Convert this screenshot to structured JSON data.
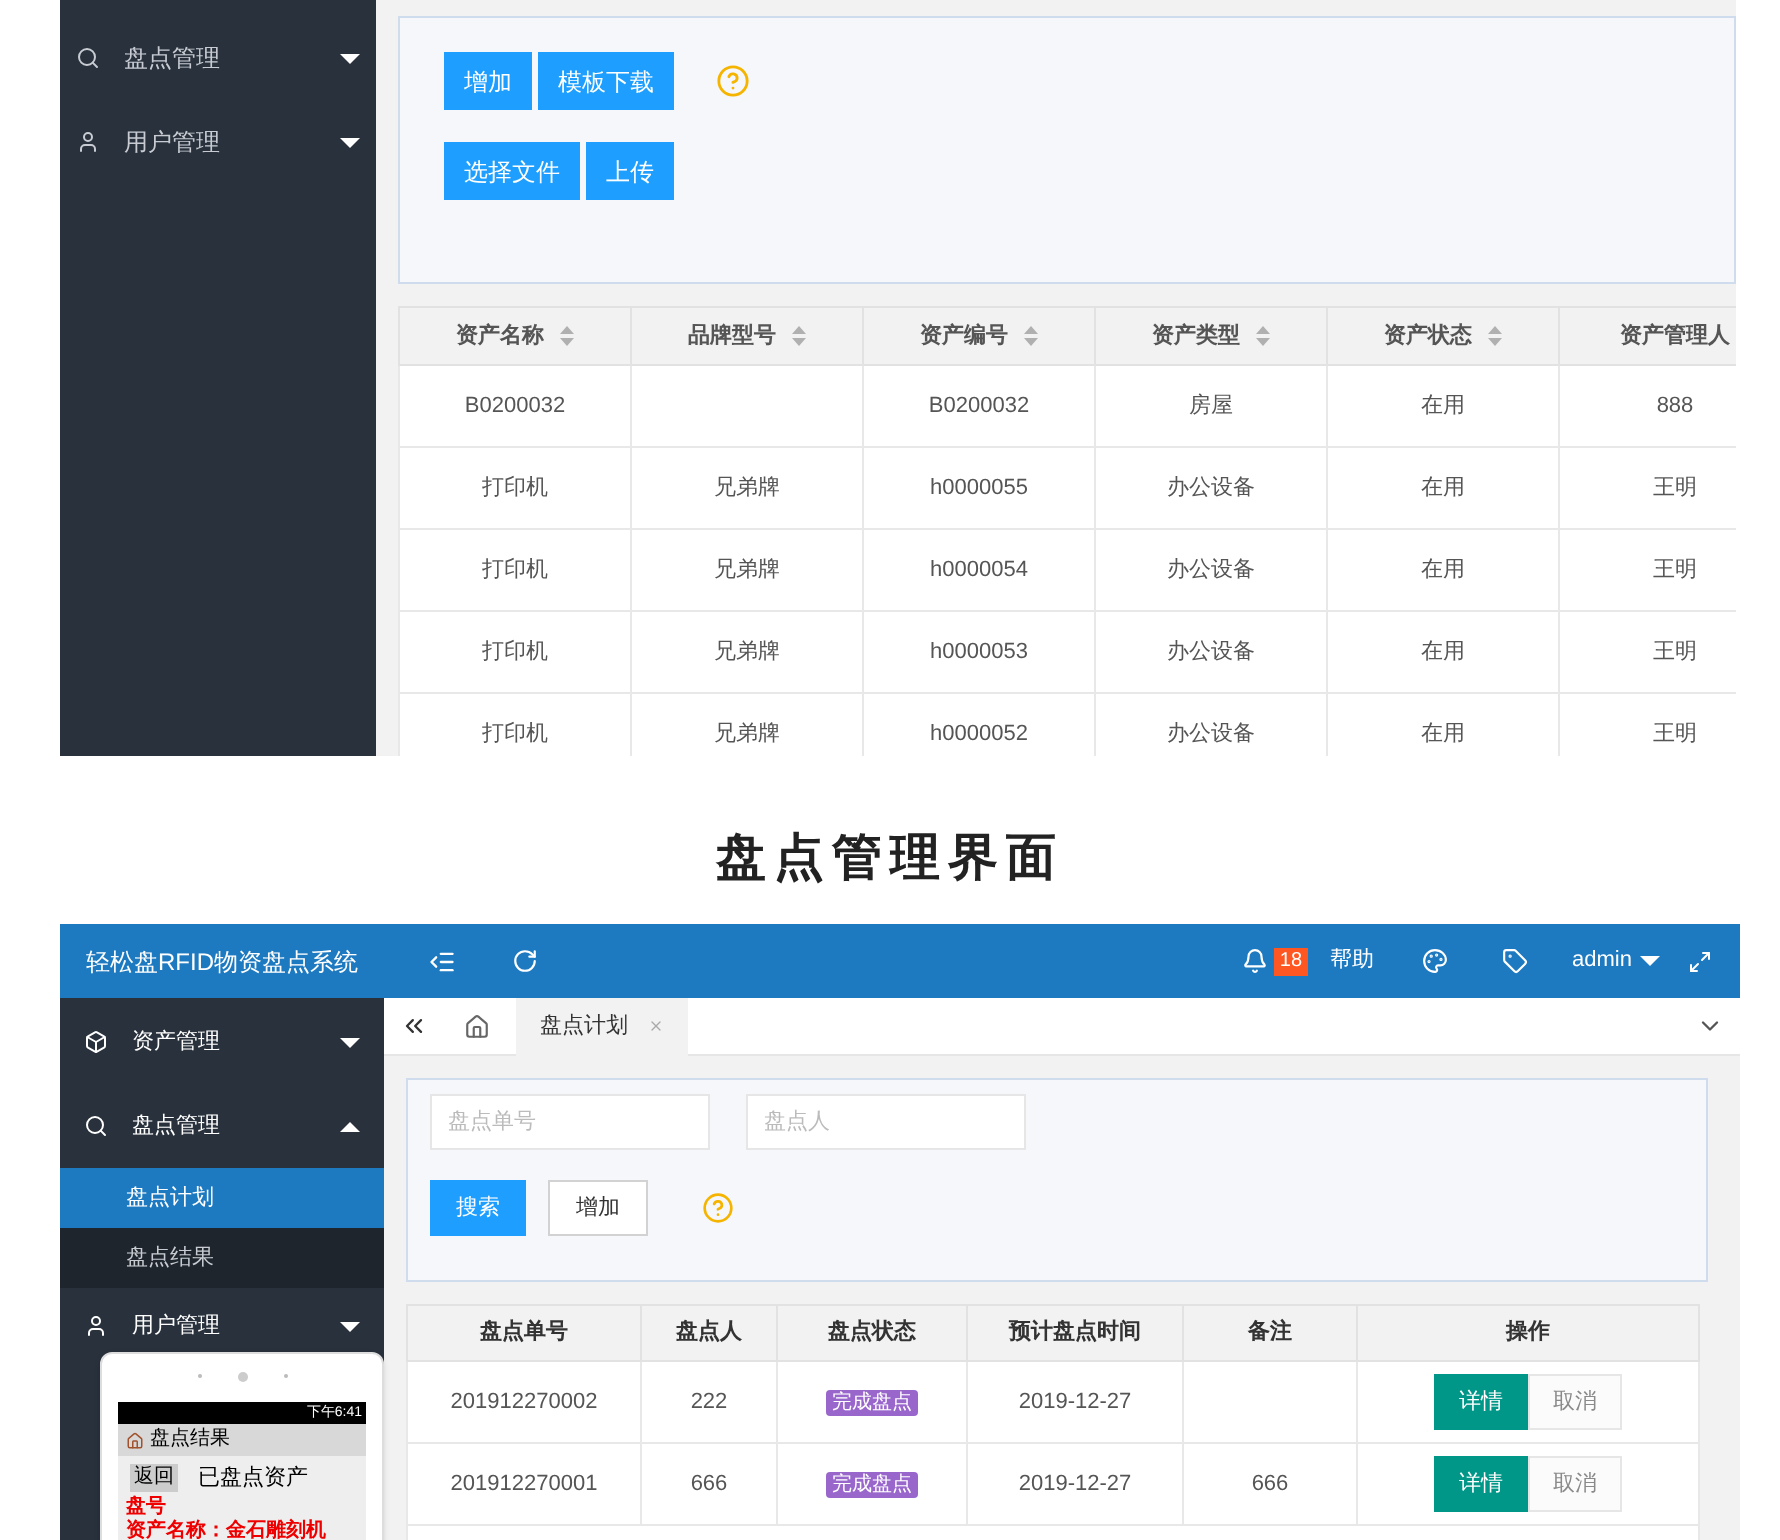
{
  "asset_screen": {
    "sidebar": {
      "items": [
        {
          "label": "盘点管理",
          "expanded": false
        },
        {
          "label": "用户管理",
          "expanded": false
        }
      ]
    },
    "toolbar": {
      "rows": [
        [
          "增加",
          "模板下载"
        ],
        [
          "选择文件",
          "上传"
        ]
      ]
    },
    "table": {
      "columns": [
        {
          "label": "资产名称",
          "sortable": true
        },
        {
          "label": "品牌型号",
          "sortable": true
        },
        {
          "label": "资产编号",
          "sortable": true
        },
        {
          "label": "资产类型",
          "sortable": true
        },
        {
          "label": "资产状态",
          "sortable": true
        },
        {
          "label": "资产管理人",
          "sortable": false
        }
      ],
      "rows": [
        [
          "B0200032",
          null,
          "B0200032",
          "房屋",
          "在用",
          "888"
        ],
        [
          "打印机",
          "兄弟牌",
          "h0000055",
          "办公设备",
          "在用",
          "王明"
        ],
        [
          "打印机",
          "兄弟牌",
          "h0000054",
          "办公设备",
          "在用",
          "王明"
        ],
        [
          "打印机",
          "兄弟牌",
          "h0000053",
          "办公设备",
          "在用",
          "王明"
        ],
        [
          "打印机",
          "兄弟牌",
          "h0000052",
          "办公设备",
          "在用",
          "王明"
        ]
      ]
    }
  },
  "heading": "盘点管理界面",
  "inventory_screen": {
    "app_title": "轻松盘RFID物资盘点系统",
    "notification_count": "18",
    "help": "帮助",
    "user": "admin",
    "sidebar": {
      "items": [
        {
          "label": "资产管理",
          "expanded": false
        },
        {
          "label": "盘点管理",
          "expanded": true,
          "children": [
            {
              "label": "盘点计划",
              "selected": true
            },
            {
              "label": "盘点结果",
              "selected": false
            }
          ]
        },
        {
          "label": "用户管理",
          "expanded": false
        }
      ]
    },
    "tabs": [
      {
        "label": "盘点计划",
        "selected": true
      }
    ],
    "search": {
      "fields": [
        {
          "placeholder": "盘点单号"
        },
        {
          "placeholder": "盘点人"
        }
      ],
      "buttons": [
        {
          "label": "搜索",
          "kind": "primary"
        },
        {
          "label": "增加",
          "kind": "plain"
        }
      ]
    },
    "table": {
      "columns": [
        "盘点单号",
        "盘点人",
        "盘点状态",
        "预计盘点时间",
        "备注",
        "操作"
      ],
      "rows": [
        {
          "cells": [
            "201912270002",
            "222",
            "完成盘点",
            "2019-12-27",
            null
          ],
          "actions": [
            {
              "label": "详情",
              "disabled": false
            },
            {
              "label": "取消",
              "disabled": true
            }
          ]
        },
        {
          "cells": [
            "201912270001",
            "666",
            "完成盘点",
            "2019-12-27",
            "666"
          ],
          "actions": [
            {
              "label": "详情",
              "disabled": false
            },
            {
              "label": "取消",
              "disabled": true
            }
          ]
        }
      ]
    }
  },
  "phone": {
    "time": "下午6:41",
    "app_bar": "盘点结果",
    "back_button": "返回",
    "title": "已盘点资产",
    "lines": [
      "盘号",
      "资产名称：金石雕刻机"
    ]
  }
}
